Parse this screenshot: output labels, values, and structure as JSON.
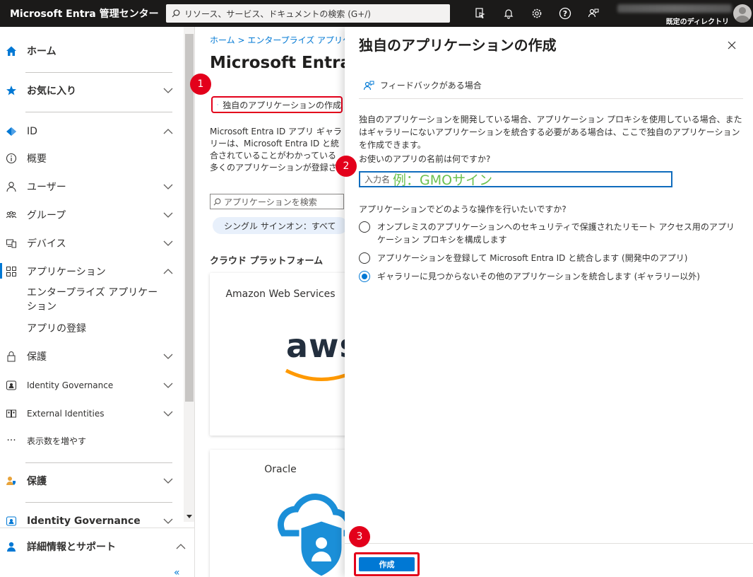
{
  "topbar": {
    "brand": "Microsoft Entra 管理センター",
    "search_placeholder": "リソース、サービス、ドキュメントの検索 (G+/)",
    "icons": [
      "cloud-shell-icon",
      "bell-icon",
      "gear-icon",
      "help-icon",
      "feedback-icon"
    ],
    "directory": "既定のディレクトリ"
  },
  "sidebar": {
    "home": "ホーム",
    "favorites": "お気に入り",
    "id": "ID",
    "overview": "概要",
    "users": "ユーザー",
    "groups": "グループ",
    "devices": "デバイス",
    "applications": "アプリケーション",
    "enterprise_apps": "エンタープライズ アプリケーション",
    "app_registrations": "アプリの登録",
    "protection": "保護",
    "identity_governance": "Identity Governance",
    "external_identities": "External Identities",
    "show_more": "表示数を増やす",
    "protection2": "保護",
    "identity_governance2": "Identity Governance",
    "learn_support": "詳細情報とサポート",
    "collapse": "«"
  },
  "middle": {
    "breadcrumb": "ホーム  >  エンタープライズ アプリケーション",
    "title": "Microsoft Entra ID",
    "create_own": "独自のアプリケーションの作成",
    "description": "Microsoft Entra ID アプリ ギャラリーは、Microsoft Entra ID と統合されていることがわかっている多くのアプリケーションが登録されているカタログです。アプリ ギャラリーからアプリを選択して、組織内のユーザーがそのアプリに接続することができます。ここで独自のアプリケーションを作成し、Microsoft Entra ID ギャラリーに追加されるように Microsoft Entra ID ギャラリーに提出できます。",
    "search_placeholder": "アプリケーションを検索",
    "filter": "シングル サインオン：すべて",
    "section": "クラウド プラットフォーム",
    "card1_title": "Amazon Web Services",
    "card1_logo": "aws",
    "card2_title": "Oracle"
  },
  "panel": {
    "title": "独自のアプリケーションの作成",
    "feedback": "フィードバックがある場合",
    "description": "独自のアプリケーションを開発している場合、アプリケーション プロキシを使用している場合、またはギャラリーにないアプリケーションを統合する必要がある場合は、ここで独自のアプリケーションを作成できます。",
    "name_question": "お使いのアプリの名前は何ですか?",
    "name_placeholder": "入力名",
    "name_example": "例：GMOサイン",
    "action_question": "アプリケーションでどのような操作を行いたいですか?",
    "options": [
      {
        "label": "オンプレミスのアプリケーションへのセキュリティで保護されたリモート アクセス用のアプリケーション プロキシを構成します",
        "checked": false
      },
      {
        "label": "アプリケーションを登録して Microsoft Entra ID と統合します (開発中のアプリ)",
        "checked": false
      },
      {
        "label": "ギャラリーに見つからないその他のアプリケーションを統合します (ギャラリー以外)",
        "checked": true
      }
    ],
    "create_button": "作成"
  },
  "steps": [
    "1",
    "2",
    "3"
  ],
  "colors": {
    "accent": "#0078d4",
    "highlight": "#e3001b",
    "topbar": "#1b1a19",
    "example_text": "#6bc14f"
  }
}
